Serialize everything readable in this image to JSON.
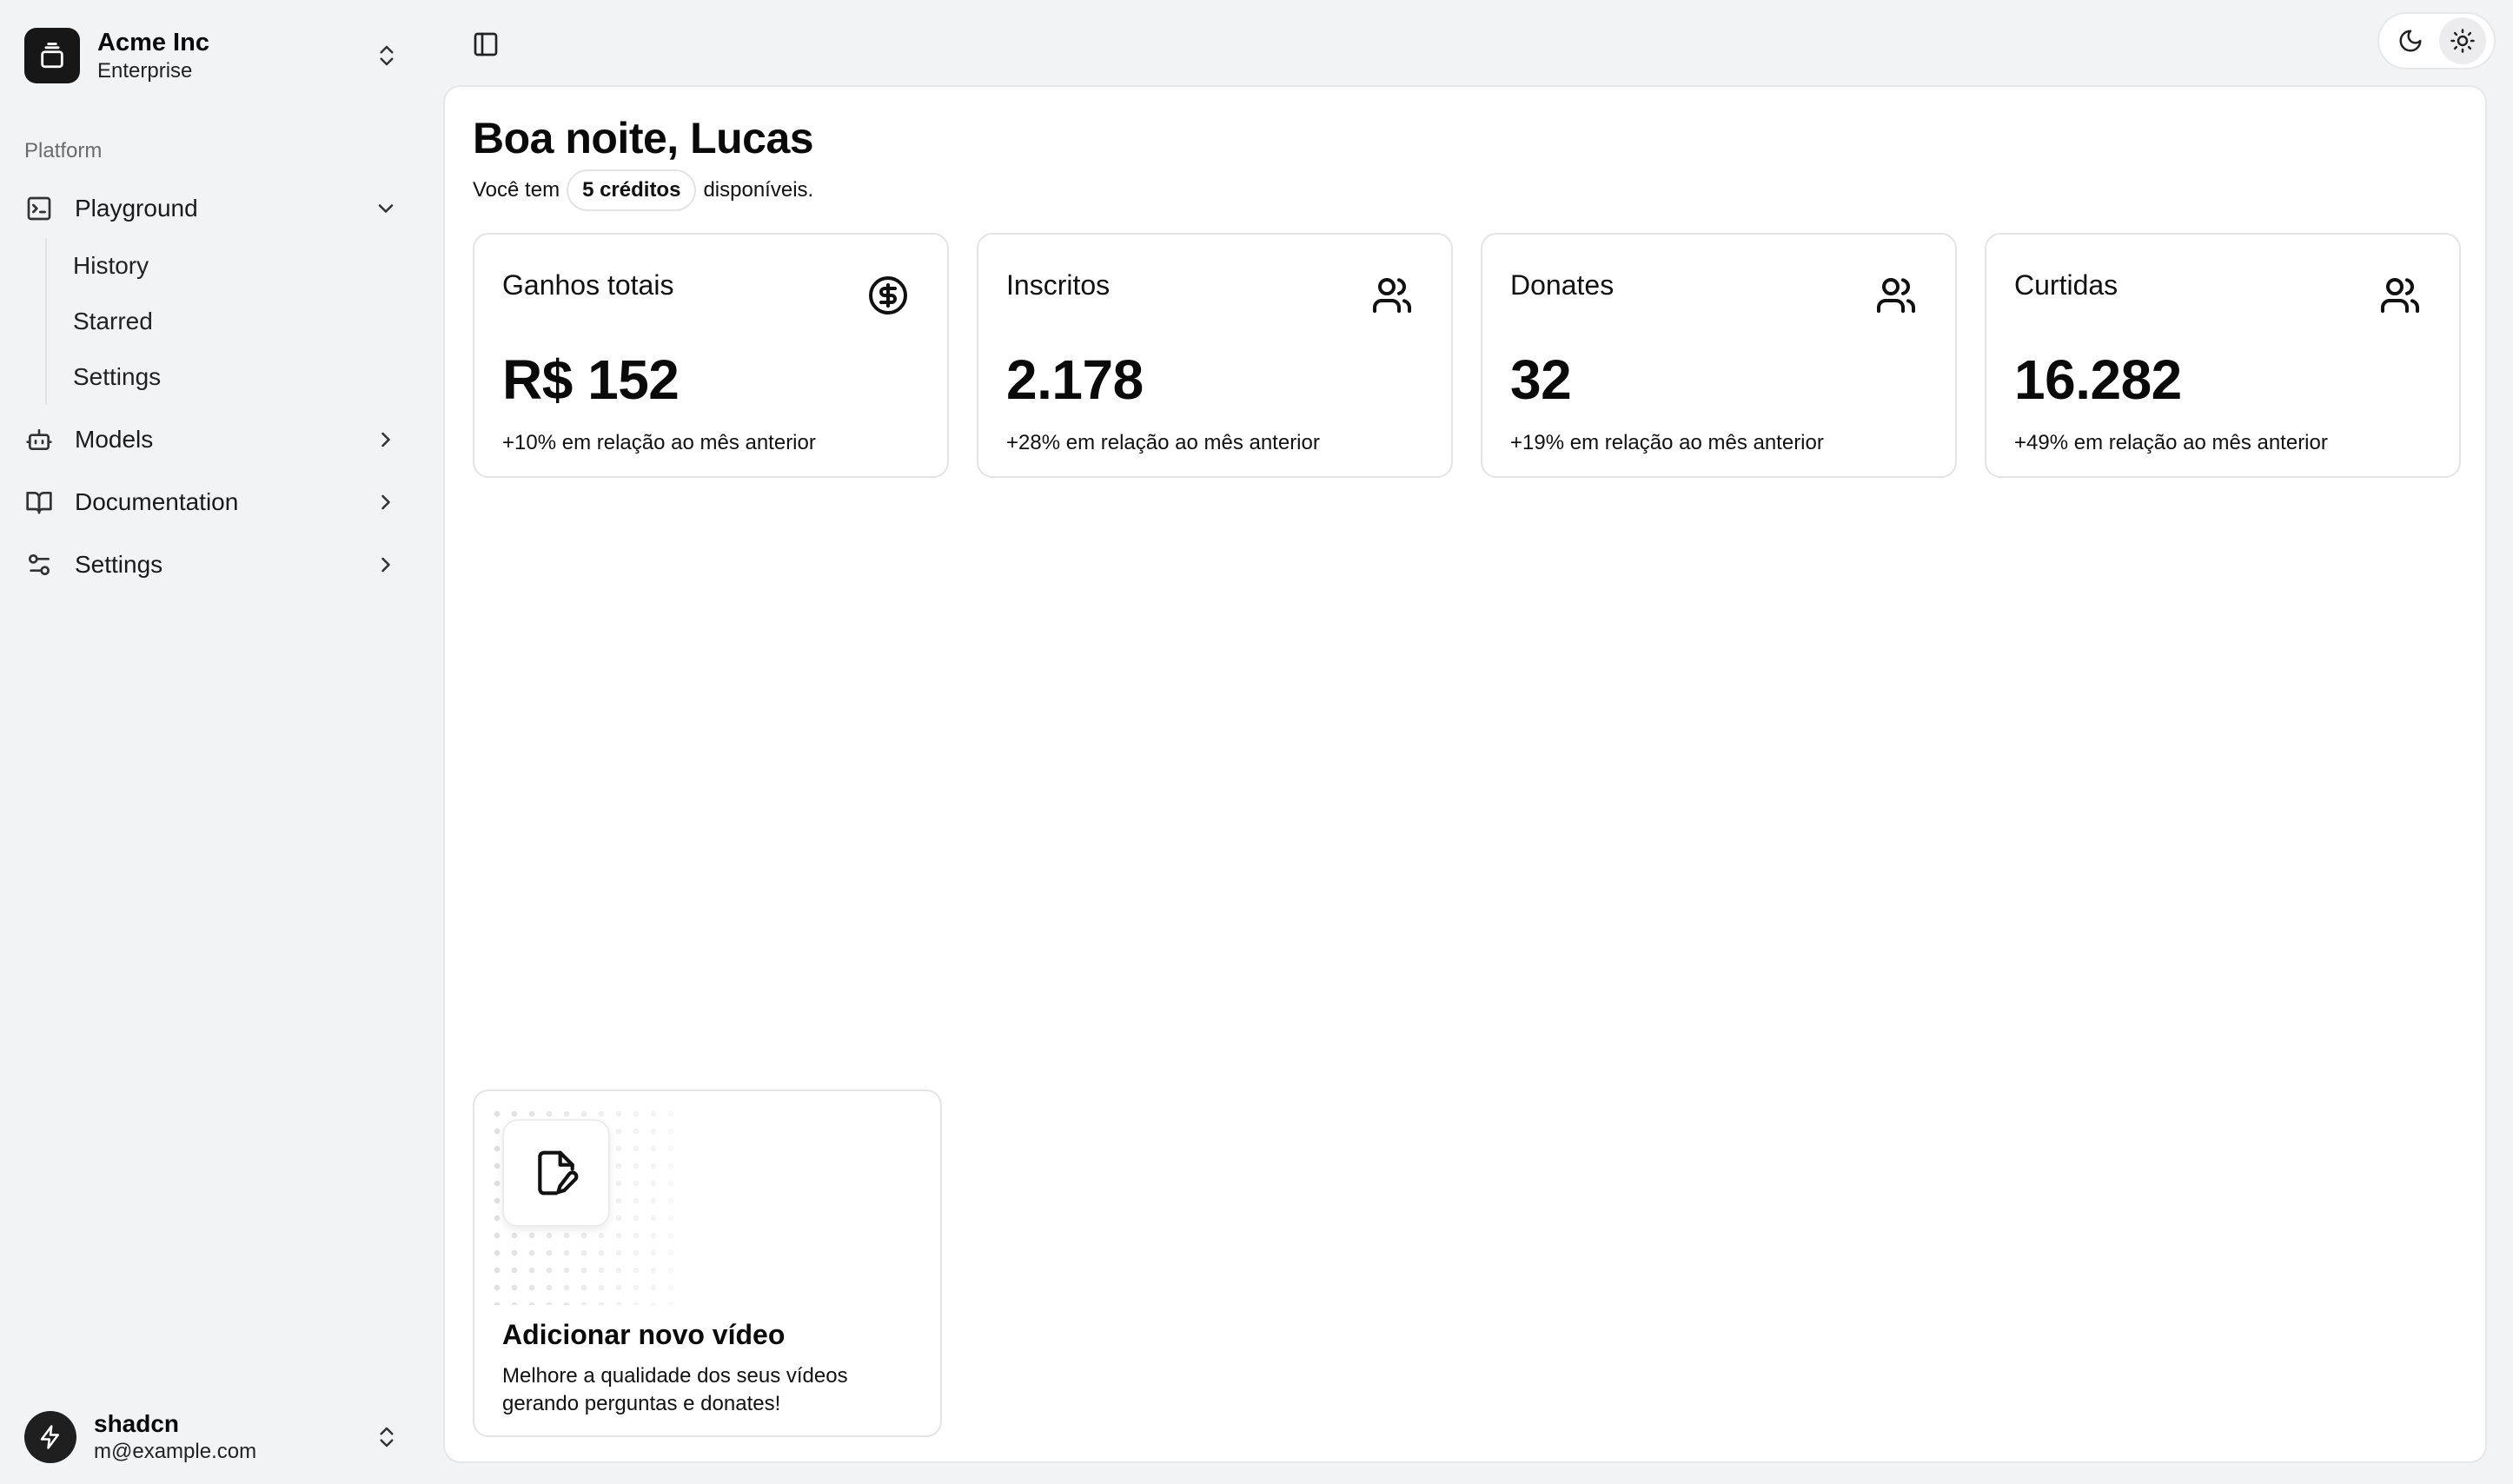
{
  "team": {
    "name": "Acme Inc",
    "plan": "Enterprise"
  },
  "sidebar": {
    "group_label": "Platform",
    "items": [
      {
        "label": "Playground",
        "icon": "terminal-square-icon",
        "expanded": true,
        "children": [
          {
            "label": "History"
          },
          {
            "label": "Starred"
          },
          {
            "label": "Settings"
          }
        ]
      },
      {
        "label": "Models",
        "icon": "bot-icon",
        "expanded": false
      },
      {
        "label": "Documentation",
        "icon": "book-open-icon",
        "expanded": false
      },
      {
        "label": "Settings",
        "icon": "settings-2-icon",
        "expanded": false
      }
    ]
  },
  "user": {
    "name": "shadcn",
    "email": "m@example.com"
  },
  "theme": {
    "options": [
      "dark",
      "light"
    ],
    "active": "light"
  },
  "main": {
    "greeting": "Boa noite, Lucas",
    "credits_prefix": "Você tem",
    "credits_badge": "5 créditos",
    "credits_suffix": "disponíveis.",
    "stats": [
      {
        "title": "Ganhos totais",
        "value": "R$ 152",
        "change": "+10% em relação ao mês anterior",
        "icon": "dollar-circle-icon"
      },
      {
        "title": "Inscritos",
        "value": "2.178",
        "change": "+28% em relação ao mês anterior",
        "icon": "users-icon"
      },
      {
        "title": "Donates",
        "value": "32",
        "change": "+19% em relação ao mês anterior",
        "icon": "users-icon"
      },
      {
        "title": "Curtidas",
        "value": "16.282",
        "change": "+49% em relação ao mês anterior",
        "icon": "users-icon"
      }
    ],
    "video_card": {
      "title": "Adicionar novo vídeo",
      "description": "Melhore a qualidade dos seus vídeos gerando perguntas e donates!",
      "icon": "file-pen-icon"
    }
  }
}
